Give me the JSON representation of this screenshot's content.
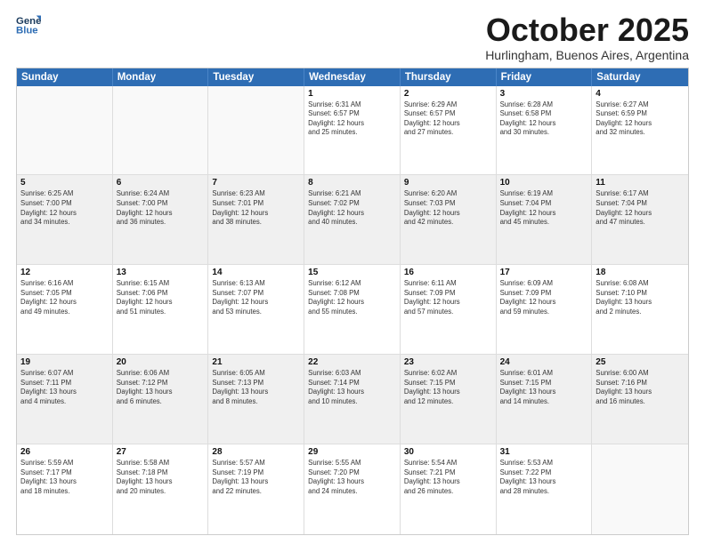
{
  "logo": {
    "line1": "General",
    "line2": "Blue"
  },
  "header": {
    "month": "October 2025",
    "location": "Hurlingham, Buenos Aires, Argentina"
  },
  "weekdays": [
    "Sunday",
    "Monday",
    "Tuesday",
    "Wednesday",
    "Thursday",
    "Friday",
    "Saturday"
  ],
  "weeks": [
    [
      {
        "day": "",
        "info": ""
      },
      {
        "day": "",
        "info": ""
      },
      {
        "day": "",
        "info": ""
      },
      {
        "day": "1",
        "info": "Sunrise: 6:31 AM\nSunset: 6:57 PM\nDaylight: 12 hours\nand 25 minutes."
      },
      {
        "day": "2",
        "info": "Sunrise: 6:29 AM\nSunset: 6:57 PM\nDaylight: 12 hours\nand 27 minutes."
      },
      {
        "day": "3",
        "info": "Sunrise: 6:28 AM\nSunset: 6:58 PM\nDaylight: 12 hours\nand 30 minutes."
      },
      {
        "day": "4",
        "info": "Sunrise: 6:27 AM\nSunset: 6:59 PM\nDaylight: 12 hours\nand 32 minutes."
      }
    ],
    [
      {
        "day": "5",
        "info": "Sunrise: 6:25 AM\nSunset: 7:00 PM\nDaylight: 12 hours\nand 34 minutes."
      },
      {
        "day": "6",
        "info": "Sunrise: 6:24 AM\nSunset: 7:00 PM\nDaylight: 12 hours\nand 36 minutes."
      },
      {
        "day": "7",
        "info": "Sunrise: 6:23 AM\nSunset: 7:01 PM\nDaylight: 12 hours\nand 38 minutes."
      },
      {
        "day": "8",
        "info": "Sunrise: 6:21 AM\nSunset: 7:02 PM\nDaylight: 12 hours\nand 40 minutes."
      },
      {
        "day": "9",
        "info": "Sunrise: 6:20 AM\nSunset: 7:03 PM\nDaylight: 12 hours\nand 42 minutes."
      },
      {
        "day": "10",
        "info": "Sunrise: 6:19 AM\nSunset: 7:04 PM\nDaylight: 12 hours\nand 45 minutes."
      },
      {
        "day": "11",
        "info": "Sunrise: 6:17 AM\nSunset: 7:04 PM\nDaylight: 12 hours\nand 47 minutes."
      }
    ],
    [
      {
        "day": "12",
        "info": "Sunrise: 6:16 AM\nSunset: 7:05 PM\nDaylight: 12 hours\nand 49 minutes."
      },
      {
        "day": "13",
        "info": "Sunrise: 6:15 AM\nSunset: 7:06 PM\nDaylight: 12 hours\nand 51 minutes."
      },
      {
        "day": "14",
        "info": "Sunrise: 6:13 AM\nSunset: 7:07 PM\nDaylight: 12 hours\nand 53 minutes."
      },
      {
        "day": "15",
        "info": "Sunrise: 6:12 AM\nSunset: 7:08 PM\nDaylight: 12 hours\nand 55 minutes."
      },
      {
        "day": "16",
        "info": "Sunrise: 6:11 AM\nSunset: 7:09 PM\nDaylight: 12 hours\nand 57 minutes."
      },
      {
        "day": "17",
        "info": "Sunrise: 6:09 AM\nSunset: 7:09 PM\nDaylight: 12 hours\nand 59 minutes."
      },
      {
        "day": "18",
        "info": "Sunrise: 6:08 AM\nSunset: 7:10 PM\nDaylight: 13 hours\nand 2 minutes."
      }
    ],
    [
      {
        "day": "19",
        "info": "Sunrise: 6:07 AM\nSunset: 7:11 PM\nDaylight: 13 hours\nand 4 minutes."
      },
      {
        "day": "20",
        "info": "Sunrise: 6:06 AM\nSunset: 7:12 PM\nDaylight: 13 hours\nand 6 minutes."
      },
      {
        "day": "21",
        "info": "Sunrise: 6:05 AM\nSunset: 7:13 PM\nDaylight: 13 hours\nand 8 minutes."
      },
      {
        "day": "22",
        "info": "Sunrise: 6:03 AM\nSunset: 7:14 PM\nDaylight: 13 hours\nand 10 minutes."
      },
      {
        "day": "23",
        "info": "Sunrise: 6:02 AM\nSunset: 7:15 PM\nDaylight: 13 hours\nand 12 minutes."
      },
      {
        "day": "24",
        "info": "Sunrise: 6:01 AM\nSunset: 7:15 PM\nDaylight: 13 hours\nand 14 minutes."
      },
      {
        "day": "25",
        "info": "Sunrise: 6:00 AM\nSunset: 7:16 PM\nDaylight: 13 hours\nand 16 minutes."
      }
    ],
    [
      {
        "day": "26",
        "info": "Sunrise: 5:59 AM\nSunset: 7:17 PM\nDaylight: 13 hours\nand 18 minutes."
      },
      {
        "day": "27",
        "info": "Sunrise: 5:58 AM\nSunset: 7:18 PM\nDaylight: 13 hours\nand 20 minutes."
      },
      {
        "day": "28",
        "info": "Sunrise: 5:57 AM\nSunset: 7:19 PM\nDaylight: 13 hours\nand 22 minutes."
      },
      {
        "day": "29",
        "info": "Sunrise: 5:55 AM\nSunset: 7:20 PM\nDaylight: 13 hours\nand 24 minutes."
      },
      {
        "day": "30",
        "info": "Sunrise: 5:54 AM\nSunset: 7:21 PM\nDaylight: 13 hours\nand 26 minutes."
      },
      {
        "day": "31",
        "info": "Sunrise: 5:53 AM\nSunset: 7:22 PM\nDaylight: 13 hours\nand 28 minutes."
      },
      {
        "day": "",
        "info": ""
      }
    ]
  ]
}
